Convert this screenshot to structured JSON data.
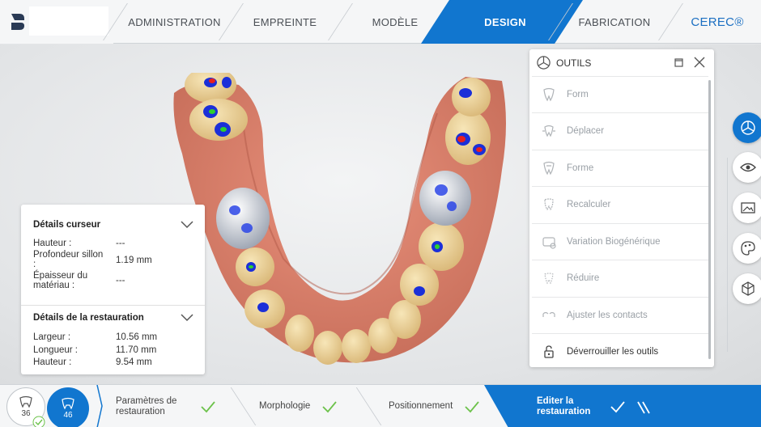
{
  "nav": {
    "tabs": [
      {
        "label": "ADMINISTRATION"
      },
      {
        "label": "EMPREINTE"
      },
      {
        "label": "MODÈLE"
      },
      {
        "label": "DESIGN"
      },
      {
        "label": "FABRICATION"
      }
    ],
    "brand": "CEREC®",
    "active_tab": "DESIGN"
  },
  "details": {
    "cursor_title": "Détails curseur",
    "cursor": [
      {
        "label": "Hauteur :",
        "value": "---"
      },
      {
        "label": "Profondeur sillon :",
        "value": "1.19 mm"
      },
      {
        "label": "Épaisseur du matériau :",
        "value": "---"
      }
    ],
    "restoration_title": "Détails de la restauration",
    "restoration": [
      {
        "label": "Largeur :",
        "value": "10.56 mm"
      },
      {
        "label": "Longueur :",
        "value": "11.70 mm"
      },
      {
        "label": "Hauteur :",
        "value": "9.54 mm"
      }
    ]
  },
  "outils": {
    "title": "OUTILS",
    "items": [
      {
        "label": "Form",
        "enabled": false,
        "icon": "form-tooth-icon"
      },
      {
        "label": "Déplacer",
        "enabled": false,
        "icon": "move-tooth-icon"
      },
      {
        "label": "Forme",
        "enabled": false,
        "icon": "shape-tooth-icon"
      },
      {
        "label": "Recalculer",
        "enabled": false,
        "icon": "recalculate-icon"
      },
      {
        "label": "Variation Biogénérique",
        "enabled": false,
        "icon": "biogeneric-icon"
      },
      {
        "label": "Réduire",
        "enabled": false,
        "icon": "reduce-icon"
      },
      {
        "label": "Ajuster les contacts",
        "enabled": false,
        "icon": "contacts-icon"
      },
      {
        "label": "Déverrouiller les outils",
        "enabled": true,
        "icon": "unlock-icon"
      }
    ]
  },
  "side_toolbar": [
    "tools-icon",
    "eye-icon",
    "image-icon",
    "palette-icon",
    "cube-icon"
  ],
  "bottom": {
    "teeth": [
      {
        "number": "36",
        "selected": false
      },
      {
        "number": "46",
        "selected": true
      }
    ],
    "steps": [
      {
        "label": "Paramètres de restauration",
        "done": true
      },
      {
        "label": "Morphologie",
        "done": true
      },
      {
        "label": "Positionnement",
        "done": true
      },
      {
        "label": "Editer la restauration",
        "done": true,
        "active": true
      }
    ]
  },
  "colors": {
    "accent": "#1176cf",
    "topbar": "#f5f6f7",
    "check": "#6cc24a"
  }
}
